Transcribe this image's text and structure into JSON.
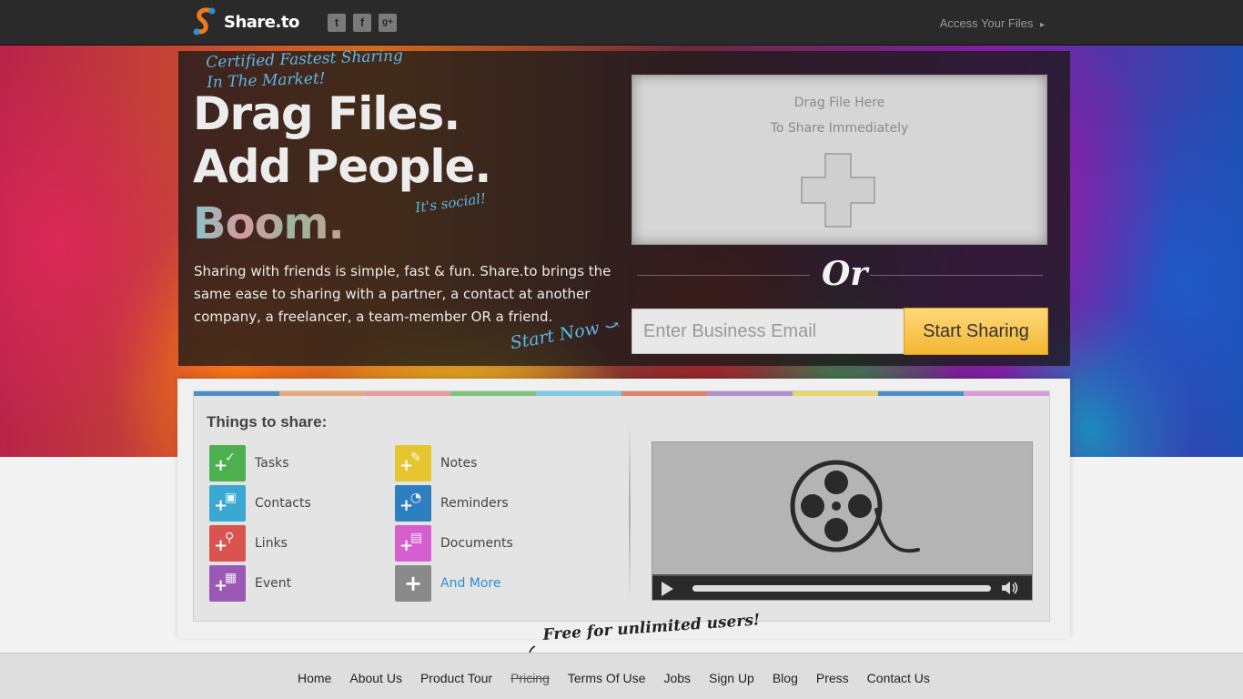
{
  "header": {
    "brand": "Share.to",
    "social": [
      {
        "name": "twitter-icon",
        "glyph": "t"
      },
      {
        "name": "facebook-icon",
        "glyph": "f"
      },
      {
        "name": "google-plus-icon",
        "glyph": "g+"
      }
    ],
    "access_label": "Access Your Files",
    "access_arrow": "▸"
  },
  "hero": {
    "tagline_line1": "Certified Fastest Sharing",
    "tagline_line2": "In The Market!",
    "headline_line1": "Drag Files.",
    "headline_line2": "Add People.",
    "headline_line3": "Boom.",
    "social_note": "It's social!",
    "description": "Sharing with friends is simple, fast & fun. Share.to brings the same ease to sharing with a partner, a contact at another company, a freelancer, a team-member OR a friend.",
    "start_now": "Start Now",
    "start_now_arrow": "⤻"
  },
  "dropzone": {
    "line1": "Drag File Here",
    "line2": "To Share Immediately"
  },
  "or_text": "Or",
  "signup": {
    "email_placeholder": "Enter Business Email",
    "button_label": "Start Sharing"
  },
  "things": {
    "title": "Things to share:",
    "strip_colors": [
      "#4a90c8",
      "#e8a87c",
      "#e89aa0",
      "#7cc47a",
      "#7ccbe8",
      "#e0826a",
      "#b48fd0",
      "#e8d66a",
      "#4a90c8",
      "#d89ad8"
    ],
    "items": [
      {
        "label": "Tasks",
        "color": "#4caf50",
        "glyph": "✓",
        "col": 0,
        "row": 0
      },
      {
        "label": "Contacts",
        "color": "#3aa8d0",
        "glyph": "▣",
        "col": 0,
        "row": 1
      },
      {
        "label": "Links",
        "color": "#d9534f",
        "glyph": "⚲",
        "col": 0,
        "row": 2
      },
      {
        "label": "Event",
        "color": "#9b59b6",
        "glyph": "▦",
        "col": 0,
        "row": 3
      },
      {
        "label": "Notes",
        "color": "#e6c630",
        "glyph": "✎",
        "col": 1,
        "row": 0
      },
      {
        "label": "Reminders",
        "color": "#2e7fc0",
        "glyph": "◔",
        "col": 1,
        "row": 1
      },
      {
        "label": "Documents",
        "color": "#d65fd0",
        "glyph": "▤",
        "col": 1,
        "row": 2
      },
      {
        "label": "And More",
        "color": "#8a8a8a",
        "glyph": "",
        "col": 1,
        "row": 3,
        "link": true
      }
    ]
  },
  "footer": {
    "free_note": "Free for unlimited users!",
    "nav": [
      {
        "label": "Home"
      },
      {
        "label": "About Us"
      },
      {
        "label": "Product Tour"
      },
      {
        "label": "Pricing",
        "struck": true
      },
      {
        "label": "Terms Of Use"
      },
      {
        "label": "Jobs"
      },
      {
        "label": "Sign Up"
      },
      {
        "label": "Blog"
      },
      {
        "label": "Press"
      },
      {
        "label": "Contact Us"
      }
    ]
  }
}
